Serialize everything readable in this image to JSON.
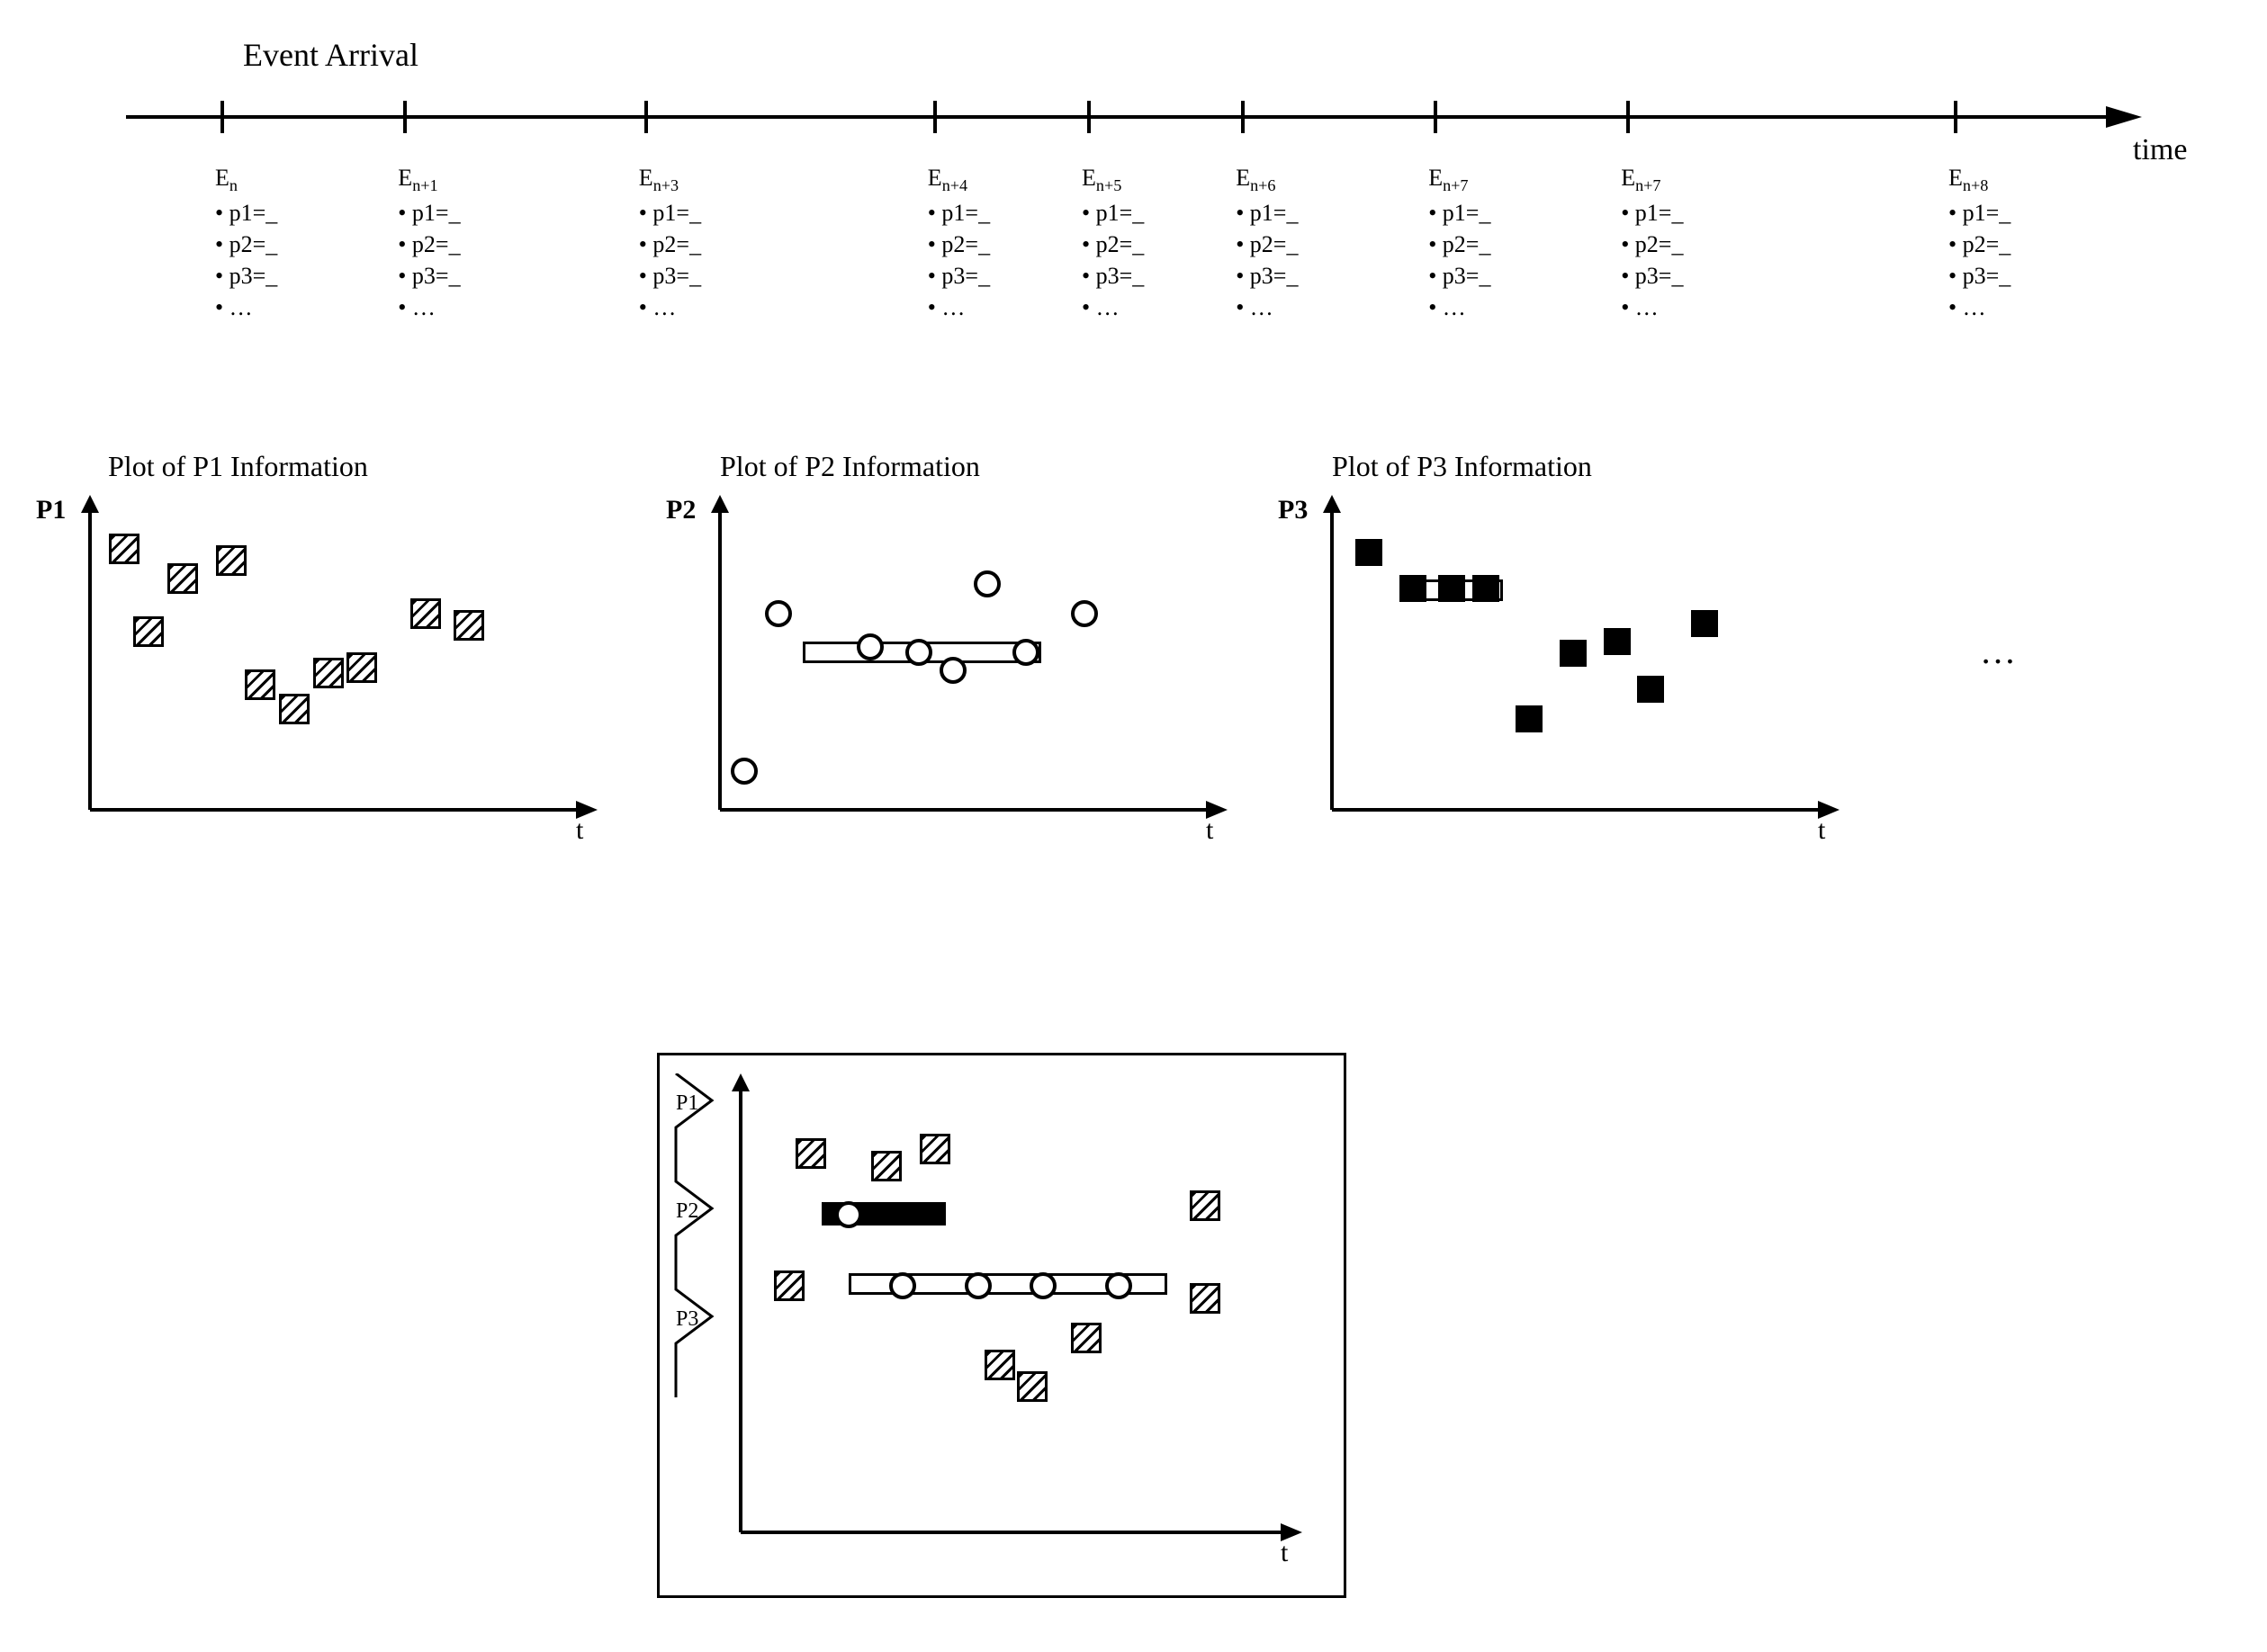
{
  "title": "Event Arrival",
  "time_axis_label": "time",
  "events": [
    {
      "label_base": "E",
      "sub": "n",
      "props": [
        "p1=_",
        "p2=_",
        "p3=_",
        "…"
      ]
    },
    {
      "label_base": "E",
      "sub": "n+1",
      "props": [
        "p1=_",
        "p2=_",
        "p3=_",
        "…"
      ]
    },
    {
      "label_base": "E",
      "sub": "n+3",
      "props": [
        "p1=_",
        "p2=_",
        "p3=_",
        "…"
      ]
    },
    {
      "label_base": "E",
      "sub": "n+4",
      "props": [
        "p1=_",
        "p2=_",
        "p3=_",
        "…"
      ]
    },
    {
      "label_base": "E",
      "sub": "n+5",
      "props": [
        "p1=_",
        "p2=_",
        "p3=_",
        "…"
      ]
    },
    {
      "label_base": "E",
      "sub": "n+6",
      "props": [
        "p1=_",
        "p2=_",
        "p3=_",
        "…"
      ]
    },
    {
      "label_base": "E",
      "sub": "n+7",
      "props": [
        "p1=_",
        "p2=_",
        "p3=_",
        "…"
      ]
    },
    {
      "label_base": "E",
      "sub": "n+7",
      "props": [
        "p1=_",
        "p2=_",
        "p3=_",
        "…"
      ]
    },
    {
      "label_base": "E",
      "sub": "n+8",
      "props": [
        "p1=_",
        "p2=_",
        "p3=_",
        "…"
      ]
    }
  ],
  "event_t_positions": [
    0.05,
    0.145,
    0.27,
    0.42,
    0.5,
    0.58,
    0.68,
    0.78,
    0.95
  ],
  "plots": {
    "t_label": "t",
    "ellipsis": "…",
    "p1": {
      "title": "Plot of P1 Information",
      "ylabel": "P1"
    },
    "p2": {
      "title": "Plot of P2 Information",
      "ylabel": "P2"
    },
    "p3": {
      "title": "Plot of P3 Information",
      "ylabel": "P3"
    }
  },
  "chart_data": [
    {
      "id": "p1",
      "type": "scatter",
      "marker": "hatched-square",
      "xlim": [
        0,
        10
      ],
      "ylim": [
        0,
        10
      ],
      "points": [
        {
          "x": 0.7,
          "y": 8.8
        },
        {
          "x": 1.2,
          "y": 6.0
        },
        {
          "x": 1.9,
          "y": 7.8
        },
        {
          "x": 2.9,
          "y": 8.4
        },
        {
          "x": 3.5,
          "y": 4.2
        },
        {
          "x": 4.2,
          "y": 3.4
        },
        {
          "x": 4.9,
          "y": 4.6
        },
        {
          "x": 5.6,
          "y": 4.8
        },
        {
          "x": 6.9,
          "y": 6.6
        },
        {
          "x": 7.8,
          "y": 6.2
        }
      ]
    },
    {
      "id": "p2",
      "type": "scatter",
      "marker": "open-circle",
      "xlim": [
        0,
        10
      ],
      "ylim": [
        0,
        10
      ],
      "bar": {
        "x1": 1.7,
        "x2": 6.5,
        "y": 5.3
      },
      "points": [
        {
          "x": 0.5,
          "y": 1.3
        },
        {
          "x": 1.2,
          "y": 6.6
        },
        {
          "x": 3.1,
          "y": 5.5
        },
        {
          "x": 4.1,
          "y": 5.3
        },
        {
          "x": 4.8,
          "y": 4.7
        },
        {
          "x": 5.5,
          "y": 7.6
        },
        {
          "x": 6.3,
          "y": 5.3
        },
        {
          "x": 7.5,
          "y": 6.6
        }
      ]
    },
    {
      "id": "p3",
      "type": "scatter",
      "marker": "solid-square",
      "xlim": [
        0,
        10
      ],
      "ylim": [
        0,
        10
      ],
      "bar": {
        "x1": 1.4,
        "x2": 3.4,
        "y": 7.4
      },
      "points": [
        {
          "x": 0.8,
          "y": 8.6
        },
        {
          "x": 1.7,
          "y": 7.4
        },
        {
          "x": 2.5,
          "y": 7.4
        },
        {
          "x": 3.2,
          "y": 7.4
        },
        {
          "x": 4.1,
          "y": 3.0
        },
        {
          "x": 5.0,
          "y": 5.2
        },
        {
          "x": 5.9,
          "y": 5.6
        },
        {
          "x": 6.6,
          "y": 4.0
        },
        {
          "x": 7.7,
          "y": 6.2
        }
      ]
    },
    {
      "id": "combined",
      "type": "scatter",
      "title": "",
      "xlim": [
        0,
        10
      ],
      "ylim": [
        0,
        10
      ],
      "y_axis_groups": [
        "P1",
        "P2",
        "P3"
      ],
      "bars": [
        {
          "kind": "solid",
          "x1": 1.5,
          "x2": 3.8,
          "y": 7.2
        },
        {
          "kind": "hollow",
          "x1": 2.0,
          "x2": 7.8,
          "y": 5.6
        }
      ],
      "points": [
        {
          "m": "hatch",
          "x": 1.3,
          "y": 8.6
        },
        {
          "m": "hatch",
          "x": 0.9,
          "y": 5.6
        },
        {
          "m": "hatch",
          "x": 2.7,
          "y": 8.3
        },
        {
          "m": "hatch",
          "x": 3.6,
          "y": 8.7
        },
        {
          "m": "circle",
          "x": 2.0,
          "y": 7.2
        },
        {
          "m": "circle",
          "x": 3.0,
          "y": 5.6
        },
        {
          "m": "circle",
          "x": 4.4,
          "y": 5.6
        },
        {
          "m": "circle",
          "x": 5.6,
          "y": 5.6
        },
        {
          "m": "hatch",
          "x": 4.8,
          "y": 3.8
        },
        {
          "m": "hatch",
          "x": 5.4,
          "y": 3.3
        },
        {
          "m": "hatch",
          "x": 6.4,
          "y": 4.4
        },
        {
          "m": "circle",
          "x": 7.0,
          "y": 5.6
        },
        {
          "m": "hatch",
          "x": 8.6,
          "y": 7.4
        },
        {
          "m": "hatch",
          "x": 8.6,
          "y": 5.3
        }
      ]
    }
  ]
}
